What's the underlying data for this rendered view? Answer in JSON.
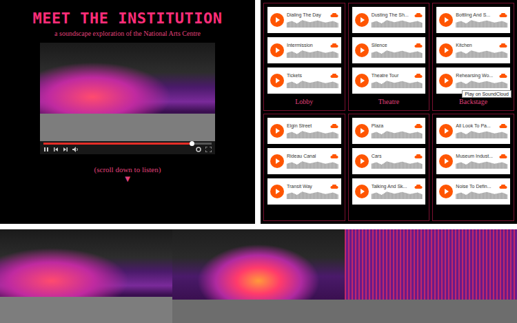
{
  "intro": {
    "title": "MEET THE INSTITUTION",
    "subtitle": "a soundscape exploration of the National Arts Centre",
    "video": {
      "progress": 0.88
    },
    "scroll_hint": "(scroll down to listen)",
    "arrow": "▼"
  },
  "sound_groups": [
    {
      "label": "Lobby",
      "tracks": [
        {
          "title": "Dialing The Day"
        },
        {
          "title": "Intermission"
        },
        {
          "title": "Tickets"
        }
      ]
    },
    {
      "label": "Theatre",
      "tracks": [
        {
          "title": "Dusting The Sh..."
        },
        {
          "title": "Silence"
        },
        {
          "title": "Theatre Tour"
        }
      ]
    },
    {
      "label": "Backstage",
      "tracks": [
        {
          "title": "Bottling And S..."
        },
        {
          "title": "Kitchen"
        },
        {
          "title": "Rehearsing Wo...",
          "tooltip": "Play on SoundCloud"
        }
      ]
    },
    {
      "tracks": [
        {
          "title": "Elgin Street"
        },
        {
          "title": "Rideau Canal"
        },
        {
          "title": "Transit Way"
        }
      ]
    },
    {
      "tracks": [
        {
          "title": "Plaza"
        },
        {
          "title": "Cars"
        },
        {
          "title": "Talking And Sk..."
        }
      ]
    },
    {
      "tracks": [
        {
          "title": "All Look To Pa..."
        },
        {
          "title": "Museum Indust..."
        },
        {
          "title": "Noise To Defin..."
        }
      ]
    }
  ]
}
